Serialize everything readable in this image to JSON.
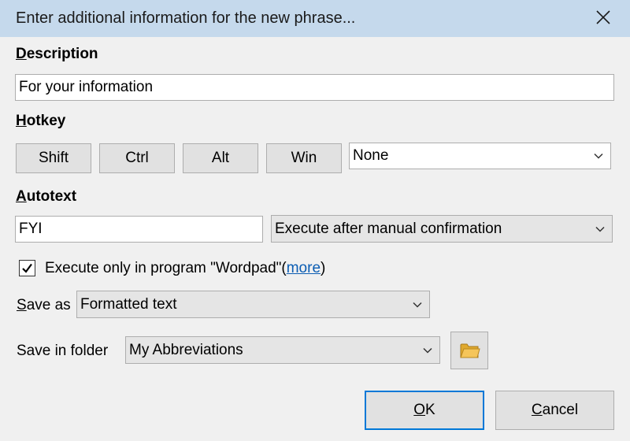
{
  "window": {
    "title": "Enter additional information for the new phrase...",
    "close_icon": "close-icon"
  },
  "description": {
    "label_accel": "D",
    "label_rest": "escription",
    "value": "For your information"
  },
  "hotkey": {
    "label_accel": "H",
    "label_rest": "otkey",
    "modifiers": [
      "Shift",
      "Ctrl",
      "Alt",
      "Win"
    ],
    "key": "None"
  },
  "autotext": {
    "label_accel": "A",
    "label_rest": "utotext",
    "value": "FYI",
    "mode": "Execute after manual confirmation"
  },
  "program_restriction": {
    "checked": true,
    "text": "Execute only in program \"Wordpad\"(",
    "link": "more",
    "text_after": ")"
  },
  "save_as": {
    "label_accel": "S",
    "label_rest": "ave as",
    "value": "Formatted text"
  },
  "save_in_folder": {
    "label": "Save in folder",
    "value": "My Abbreviations",
    "browse_icon": "folder-icon"
  },
  "buttons": {
    "ok_accel": "O",
    "ok_rest": "K",
    "cancel_accel": "C",
    "cancel_rest": "ancel"
  },
  "colors": {
    "titlebar": "#c5d9ec",
    "dialog_bg": "#f0f0f0",
    "link": "#0b5db3",
    "default_button_border": "#0078d7"
  }
}
